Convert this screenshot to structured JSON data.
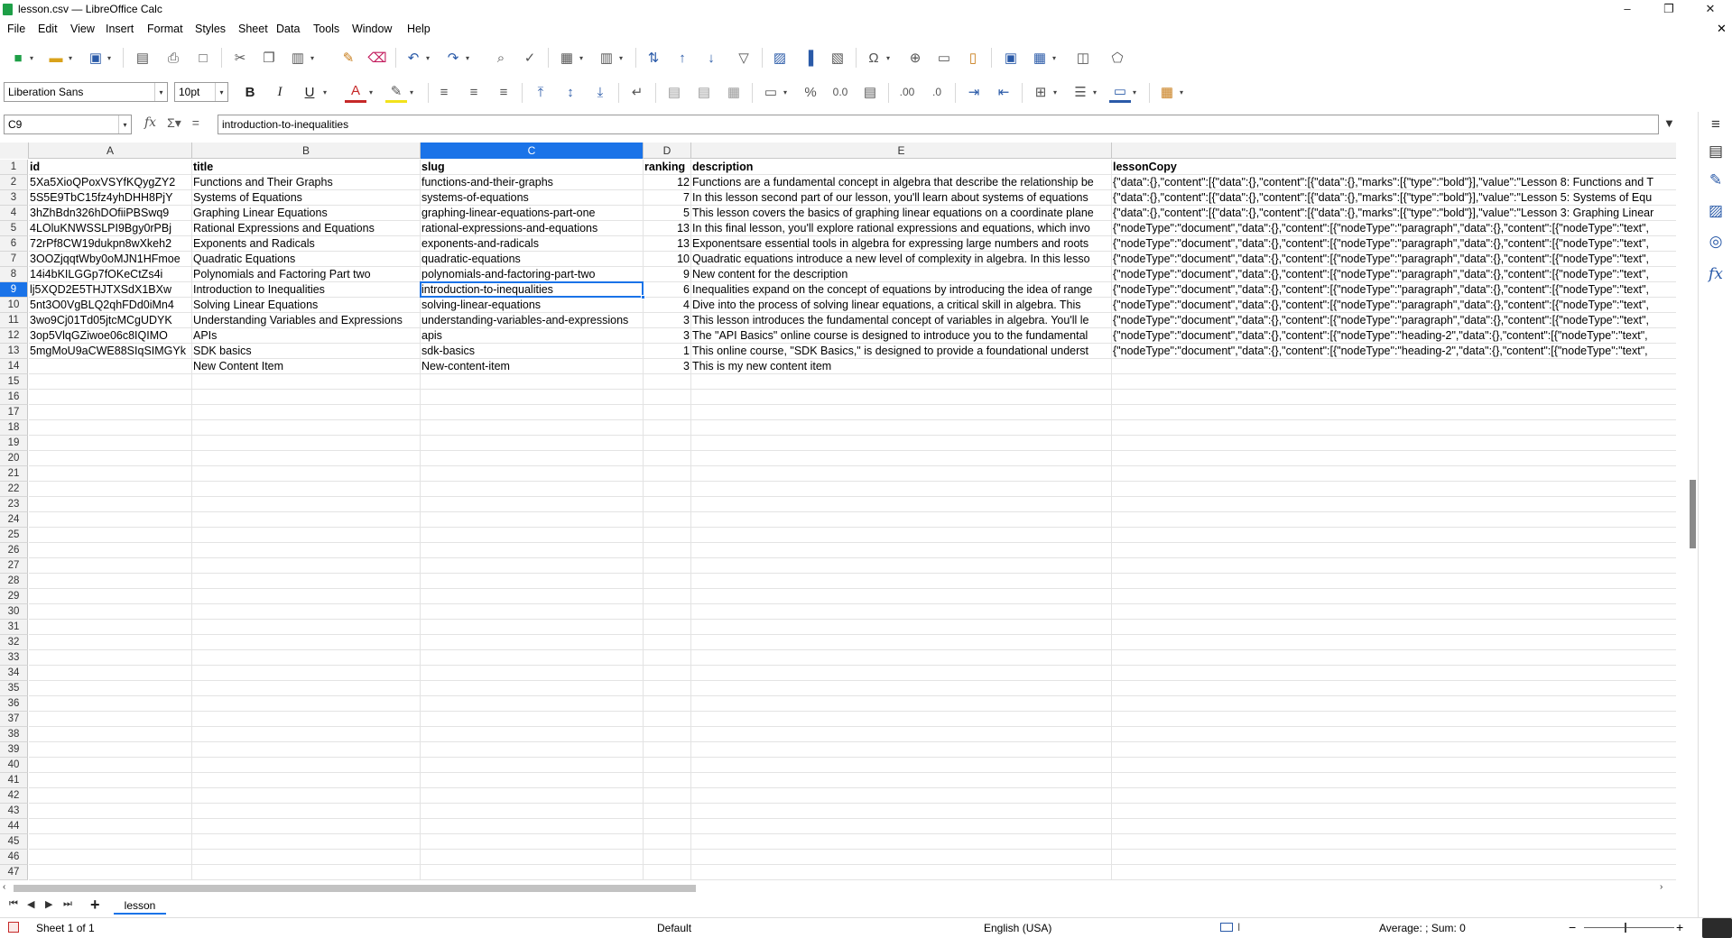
{
  "window": {
    "title": "lesson.csv — LibreOffice Calc"
  },
  "menu": [
    "File",
    "Edit",
    "View",
    "Insert",
    "Format",
    "Styles",
    "Sheet",
    "Data",
    "Tools",
    "Window",
    "Help"
  ],
  "toolbar2": {
    "font_name": "Liberation Sans",
    "font_size": "10pt"
  },
  "formula_bar": {
    "cell_ref": "C9",
    "content": "introduction-to-inequalities"
  },
  "columns": [
    {
      "label": "A"
    },
    {
      "label": "B"
    },
    {
      "label": "C"
    },
    {
      "label": "D"
    },
    {
      "label": "E"
    },
    {
      "label": ""
    }
  ],
  "selected": {
    "col": "C",
    "row": "9"
  },
  "rows": [
    {
      "num": "1",
      "cells": [
        "id",
        "title",
        "slug",
        "ranking",
        "description",
        "lessonCopy"
      ]
    },
    {
      "num": "2",
      "cells": [
        "5Xa5XioQPoxVSYfKQygZY2",
        "Functions and Their Graphs",
        "functions-and-their-graphs",
        "12",
        "Functions are a fundamental concept in algebra that describe the relationship be",
        "{\"data\":{},\"content\":[{\"data\":{},\"content\":[{\"data\":{},\"marks\":[{\"type\":\"bold\"}],\"value\":\"Lesson 8: Functions and T"
      ]
    },
    {
      "num": "3",
      "cells": [
        "5S5E9TbC15fz4yhDHH8PjY",
        "Systems of Equations",
        "systems-of-equations",
        "7",
        "In this lesson second part of our lesson, you'll learn about systems of equations",
        "{\"data\":{},\"content\":[{\"data\":{},\"content\":[{\"data\":{},\"marks\":[{\"type\":\"bold\"}],\"value\":\"Lesson 5: Systems of Equ"
      ]
    },
    {
      "num": "4",
      "cells": [
        "3hZhBdn326hDOfiiPBSwq9",
        "Graphing Linear Equations",
        "graphing-linear-equations-part-one",
        "5",
        "This lesson covers the basics of graphing linear equations on a coordinate plane",
        "{\"data\":{},\"content\":[{\"data\":{},\"content\":[{\"data\":{},\"marks\":[{\"type\":\"bold\"}],\"value\":\"Lesson 3: Graphing Linear"
      ]
    },
    {
      "num": "5",
      "cells": [
        "4LOluKNWSSLPI9Bgy0rPBj",
        "Rational Expressions and Equations",
        "rational-expressions-and-equations",
        "13",
        "In this final lesson, you'll explore rational expressions and equations, which invo",
        "{\"nodeType\":\"document\",\"data\":{},\"content\":[{\"nodeType\":\"paragraph\",\"data\":{},\"content\":[{\"nodeType\":\"text\","
      ]
    },
    {
      "num": "6",
      "cells": [
        "72rPf8CW19dukpn8wXkeh2",
        "Exponents and Radicals",
        "exponents-and-radicals",
        "13",
        "Exponentsare essential tools in algebra for expressing large numbers and roots",
        "{\"nodeType\":\"document\",\"data\":{},\"content\":[{\"nodeType\":\"paragraph\",\"data\":{},\"content\":[{\"nodeType\":\"text\","
      ]
    },
    {
      "num": "7",
      "cells": [
        "3OOZjqqtWby0oMJN1HFmoe",
        "Quadratic Equations",
        "quadratic-equations",
        "10",
        "Quadratic equations introduce a new level of complexity in algebra. In this lesso",
        "{\"nodeType\":\"document\",\"data\":{},\"content\":[{\"nodeType\":\"paragraph\",\"data\":{},\"content\":[{\"nodeType\":\"text\","
      ]
    },
    {
      "num": "8",
      "cells": [
        "14i4bKILGGp7fOKeCtZs4i",
        "Polynomials and Factoring Part two",
        "polynomials-and-factoring-part-two",
        "9",
        "New content for the description",
        "{\"nodeType\":\"document\",\"data\":{},\"content\":[{\"nodeType\":\"paragraph\",\"data\":{},\"content\":[{\"nodeType\":\"text\","
      ]
    },
    {
      "num": "9",
      "cells": [
        "lj5XQD2E5THJTXSdX1BXw",
        "Introduction to Inequalities",
        "introduction-to-inequalities",
        "6",
        "Inequalities expand on the concept of equations by introducing the idea of range",
        "{\"nodeType\":\"document\",\"data\":{},\"content\":[{\"nodeType\":\"paragraph\",\"data\":{},\"content\":[{\"nodeType\":\"text\","
      ]
    },
    {
      "num": "10",
      "cells": [
        "5nt3O0VgBLQ2qhFDd0iMn4",
        "Solving Linear Equations",
        "solving-linear-equations",
        "4",
        "Dive into the process of solving linear equations, a critical skill in algebra. This",
        "{\"nodeType\":\"document\",\"data\":{},\"content\":[{\"nodeType\":\"paragraph\",\"data\":{},\"content\":[{\"nodeType\":\"text\","
      ]
    },
    {
      "num": "11",
      "cells": [
        "3wo9Cj01Td05jtcMCgUDYK",
        "Understanding Variables and Expressions",
        "understanding-variables-and-expressions",
        "3",
        "This lesson introduces the fundamental concept of variables in algebra. You'll le",
        "{\"nodeType\":\"document\",\"data\":{},\"content\":[{\"nodeType\":\"paragraph\",\"data\":{},\"content\":[{\"nodeType\":\"text\","
      ]
    },
    {
      "num": "12",
      "cells": [
        "3op5VlqGZiwoe06c8IQIMO",
        "APIs",
        "apis",
        "3",
        "The \"API Basics\" online course is designed to introduce you to the fundamental",
        "{\"nodeType\":\"document\",\"data\":{},\"content\":[{\"nodeType\":\"heading-2\",\"data\":{},\"content\":[{\"nodeType\":\"text\","
      ]
    },
    {
      "num": "13",
      "cells": [
        "5mgMoU9aCWE88SIqSIMGYk",
        "SDK basics",
        "sdk-basics",
        "1",
        "This online course, \"SDK Basics,\" is designed to provide a foundational underst",
        "{\"nodeType\":\"document\",\"data\":{},\"content\":[{\"nodeType\":\"heading-2\",\"data\":{},\"content\":[{\"nodeType\":\"text\","
      ]
    },
    {
      "num": "14",
      "cells": [
        "",
        "New Content Item",
        "New-content-item",
        "3",
        "This is my new content item",
        ""
      ]
    }
  ],
  "empty_row_numbers": [
    "15",
    "16",
    "17",
    "18",
    "19",
    "20",
    "21",
    "22",
    "23",
    "24",
    "25",
    "26",
    "27",
    "28",
    "29",
    "30",
    "31",
    "32",
    "33",
    "34",
    "35",
    "36",
    "37",
    "38",
    "39",
    "40",
    "41",
    "42",
    "43",
    "44",
    "45",
    "46",
    "47"
  ],
  "sheet_tabs": [
    "lesson"
  ],
  "status": {
    "sheet": "Sheet 1 of 1",
    "page_style": "Default",
    "language": "English (USA)",
    "summary": "Average: ; Sum: 0"
  }
}
